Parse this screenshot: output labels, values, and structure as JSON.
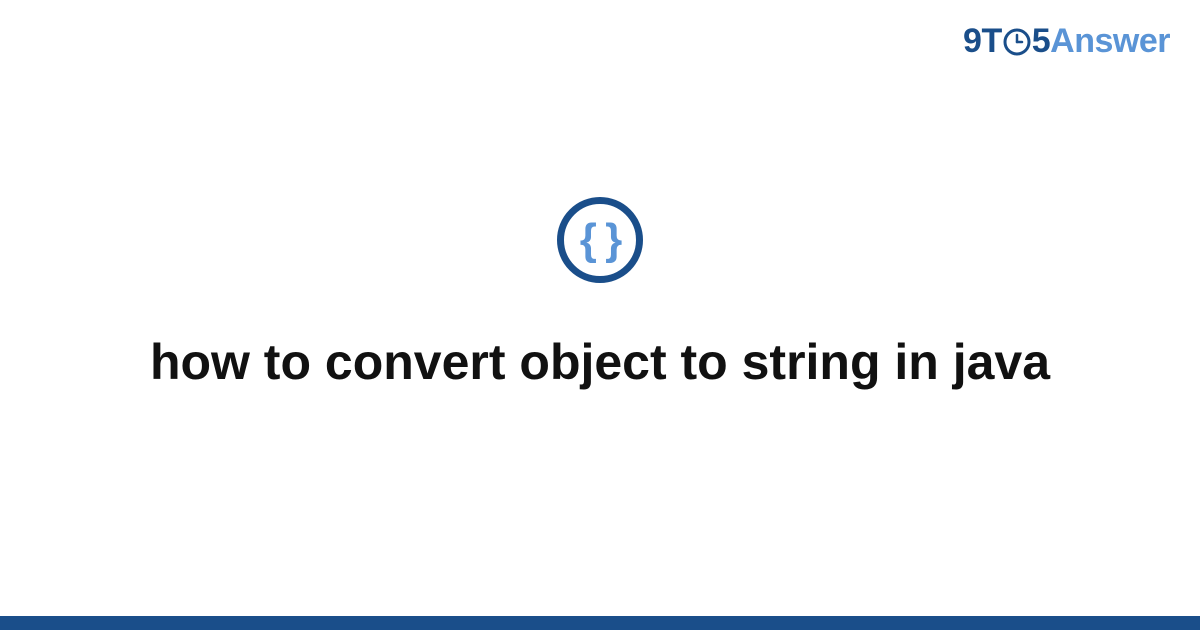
{
  "brand": {
    "part1": "9",
    "part2": "T",
    "part3": "5",
    "part4": "Answer"
  },
  "icon": {
    "braces": "{ }",
    "name": "code-braces-icon"
  },
  "title": "how to convert object to string in java",
  "colors": {
    "primary": "#1a4e8a",
    "accent": "#5a94d6"
  }
}
